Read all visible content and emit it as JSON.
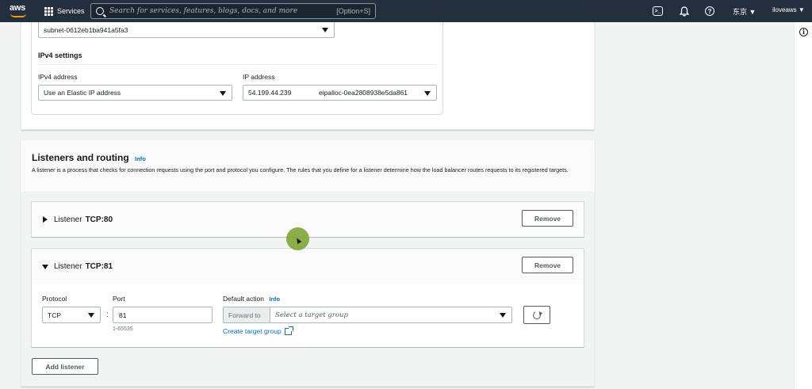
{
  "topnav": {
    "logo_text": "aws",
    "services_label": "Services",
    "search_placeholder": "Search for services, features, blogs, docs, and more",
    "search_shortcut": "[Option+S]",
    "cloudshell_glyph": ">_",
    "help_glyph": "?",
    "region_label": "东京 ▼",
    "account_label": "iloveaws ▼"
  },
  "right_rail": {
    "info_glyph": "i"
  },
  "network": {
    "subnet_value": "subnet-0612eb1ba941a5fa3",
    "ipv4_settings_heading": "IPv4 settings",
    "ipv4_address_label": "IPv4 address",
    "ipv4_address_value": "Use an Elastic IP address",
    "ip_address_label": "IP address",
    "ip_address_value": "54.199.44.239",
    "allocation_id": "eipalloc-0ea2808938e5da861"
  },
  "listeners": {
    "title": "Listeners and routing",
    "info_label": "Info",
    "description": "A listener is a process that checks for connection requests using the port and protocol you configure. The rules that you define for a listener determine how the load balancer routes requests to its registered targets.",
    "items": [
      {
        "prefix": "Listener",
        "name": "TCP:80",
        "remove_label": "Remove",
        "expanded": false
      },
      {
        "prefix": "Listener",
        "name": "TCP:81",
        "remove_label": "Remove",
        "expanded": true
      }
    ],
    "form": {
      "protocol_label": "Protocol",
      "protocol_value": "TCP",
      "port_label": "Port",
      "port_separator": ":",
      "port_value": "81",
      "port_hint": "1-65535",
      "default_action_label": "Default action",
      "default_action_info": "Info",
      "forward_to_label": "Forward to",
      "target_group_placeholder": "Select a target group",
      "create_target_group_label": "Create target group"
    },
    "add_listener_label": "Add listener"
  },
  "colors": {
    "nav_bg": "#232f3e",
    "link_blue": "#0073bb",
    "cursor_green": "#7fa532",
    "aws_orange": "#ff9900"
  },
  "icons": [
    "grid-icon",
    "search-icon",
    "cloudshell-icon",
    "bell-icon",
    "help-icon",
    "info-icon",
    "caret-down-icon",
    "expand-triangle-icon",
    "external-link-icon",
    "refresh-icon"
  ]
}
